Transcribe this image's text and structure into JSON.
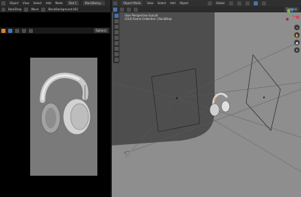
{
  "left_editor": {
    "menu": [
      "Object",
      "View",
      "Select",
      "Add",
      "Mode"
    ],
    "slot": "Slot 1",
    "material": "BlackBacky...",
    "backdrop_tab": "BackDrop",
    "shading_label": "Wave",
    "image_name": "BlackBackground.002",
    "options": "Options"
  },
  "right_editor": {
    "mode": "Object Mode",
    "menu": [
      "View",
      "Select",
      "Add",
      "Object"
    ],
    "transform": "Global",
    "options": "Options",
    "viewport_title": "User Perspective (Local)",
    "viewport_subtitle": "(214) Scene Collection | BackDrop",
    "gizmo_axes": [
      "X",
      "Y",
      "Z"
    ]
  },
  "colors": {
    "viewport_bg": "#8b8b8b",
    "accent": "#4772b3",
    "header": "#2a2a2a",
    "x_axis": "#e04055",
    "y_axis": "#7fbf3a",
    "z_axis": "#4a88d8"
  }
}
